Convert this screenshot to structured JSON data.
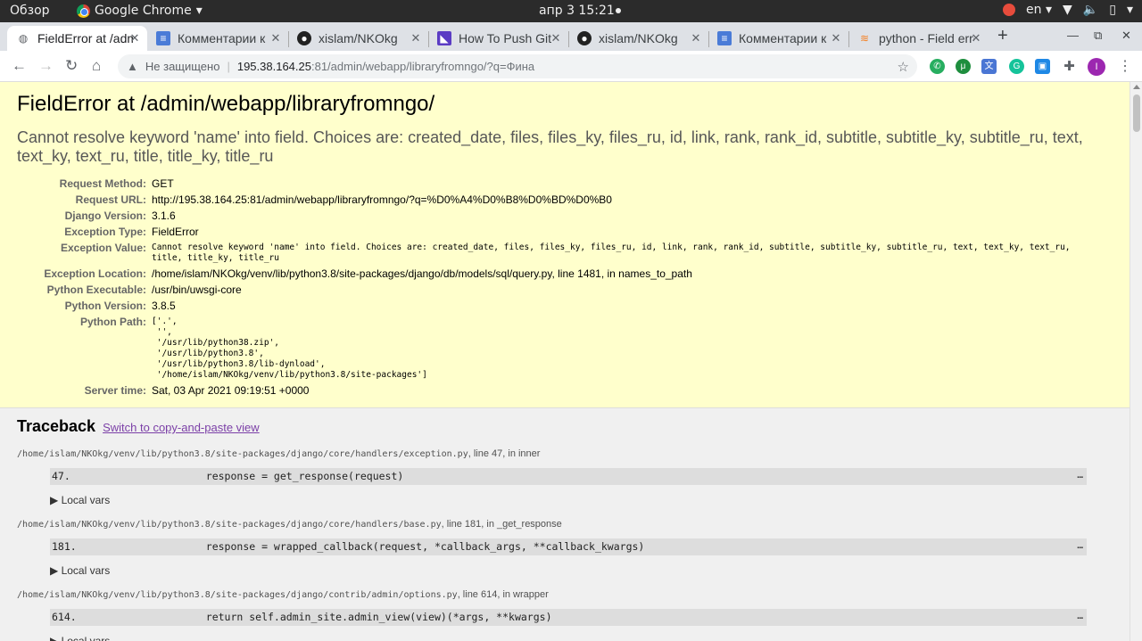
{
  "system_bar": {
    "activities": "Обзор",
    "app_name": "Google Chrome",
    "clock": "апр 3  15:21",
    "language": "en"
  },
  "tabs": [
    {
      "title": "FieldError at /admin/",
      "icon": "globe-icon",
      "active": true
    },
    {
      "title": "Комментарии к",
      "icon": "docs-icon"
    },
    {
      "title": "xislam/NKOkg",
      "icon": "github-icon"
    },
    {
      "title": "How To Push Git",
      "icon": "hashnode-icon"
    },
    {
      "title": "xislam/NKOkg",
      "icon": "github-icon"
    },
    {
      "title": "Комментарии к",
      "icon": "docs-icon"
    },
    {
      "title": "python - Field error",
      "icon": "stackoverflow-icon"
    }
  ],
  "omnibox": {
    "security_label": "Не защищено",
    "host": "195.38.164.25",
    "path": ":81/admin/webapp/libraryfromngo/?q=Фина"
  },
  "error": {
    "title": "FieldError at /admin/webapp/libraryfromngo/",
    "message": "Cannot resolve keyword 'name' into field. Choices are: created_date, files, files_ky, files_ru, id, link, rank, rank_id, subtitle, subtitle_ky, subtitle_ru, text, text_ky, text_ru, title, title_ky, title_ru"
  },
  "meta": [
    {
      "label": "Request Method:",
      "value": "GET"
    },
    {
      "label": "Request URL:",
      "value": "http://195.38.164.25:81/admin/webapp/libraryfromngo/?q=%D0%A4%D0%B8%D0%BD%D0%B0"
    },
    {
      "label": "Django Version:",
      "value": "3.1.6"
    },
    {
      "label": "Exception Type:",
      "value": "FieldError"
    },
    {
      "label": "Exception Value:",
      "value": "Cannot resolve keyword 'name' into field. Choices are: created_date, files, files_ky, files_ru, id, link, rank, rank_id, subtitle, subtitle_ky, subtitle_ru, text, text_ky, text_ru, title, title_ky, title_ru"
    },
    {
      "label": "Exception Location:",
      "value": "/home/islam/NKOkg/venv/lib/python3.8/site-packages/django/db/models/sql/query.py, line 1481, in names_to_path"
    },
    {
      "label": "Python Executable:",
      "value": "/usr/bin/uwsgi-core"
    },
    {
      "label": "Python Version:",
      "value": "3.8.5"
    },
    {
      "label": "Python Path:",
      "value": "['.',\n '',\n '/usr/lib/python38.zip',\n '/usr/lib/python3.8',\n '/usr/lib/python3.8/lib-dynload',\n '/home/islam/NKOkg/venv/lib/python3.8/site-packages']"
    },
    {
      "label": "Server time:",
      "value": "Sat, 03 Apr 2021 09:19:51 +0000"
    }
  ],
  "traceback": {
    "heading": "Traceback",
    "switch_link": "Switch to copy-and-paste view",
    "local_vars_label": "▶ Local vars",
    "frames": [
      {
        "file": "/home/islam/NKOkg/venv/lib/python3.8/site-packages/django/core/handlers/exception.py",
        "suffix": ", line 47, in inner",
        "line_no": "47.",
        "code": "                response = get_response(request)"
      },
      {
        "file": "/home/islam/NKOkg/venv/lib/python3.8/site-packages/django/core/handlers/base.py",
        "suffix": ", line 181, in _get_response",
        "line_no": "181.",
        "code": "                response = wrapped_callback(request, *callback_args, **callback_kwargs)"
      },
      {
        "file": "/home/islam/NKOkg/venv/lib/python3.8/site-packages/django/contrib/admin/options.py",
        "suffix": ", line 614, in wrapper",
        "line_no": "614.",
        "code": "                return self.admin_site.admin_view(view)(*args, **kwargs)"
      }
    ]
  }
}
